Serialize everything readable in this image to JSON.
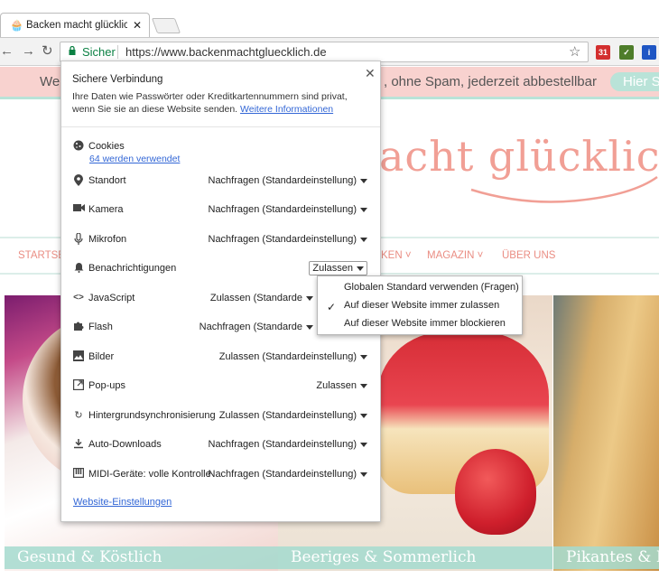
{
  "browser": {
    "tab_title": "Backen macht glücklich -",
    "tab_favicon": "cupcake-icon",
    "omnibox": {
      "secure_label": "Sicher",
      "url": "https://www.backenmachtgluecklich.de"
    },
    "extensions": [
      "calendar-extension-icon",
      "checklist-extension-icon",
      "info-extension-icon"
    ]
  },
  "page": {
    "banner_left": "Wei",
    "banner_text": ", ohne Spam, jederzeit abbestellbar",
    "banner_button": "Hier S",
    "logo_text": "acht glücklich",
    "nav": {
      "startseite": "STARTSE",
      "backen": "KEN",
      "magazin": "MAGAZIN",
      "ueber_uns": "ÜBER UNS"
    },
    "captions": [
      "Gesund & Köstlich",
      "Beeriges & Sommerlich",
      "Pikantes & Fin"
    ]
  },
  "popup": {
    "title": "Sichere Verbindung",
    "description": "Ihre Daten wie Passwörter oder Kreditkartennummern sind privat, wenn Sie sie an diese Website senden.",
    "more_info_link": "Weitere Informationen",
    "cookies": {
      "label": "Cookies",
      "link": "64 werden verwendet"
    },
    "permissions": [
      {
        "id": "standort",
        "label": "Standort",
        "value": "Nachfragen (Standardeinstellung)",
        "icon": "location-pin-icon"
      },
      {
        "id": "kamera",
        "label": "Kamera",
        "value": "Nachfragen (Standardeinstellung)",
        "icon": "camera-icon"
      },
      {
        "id": "mikrofon",
        "label": "Mikrofon",
        "value": "Nachfragen (Standardeinstellung)",
        "icon": "microphone-icon"
      },
      {
        "id": "benachrichtigungen",
        "label": "Benachrichtigungen",
        "value": "Zulassen",
        "icon": "bell-icon"
      },
      {
        "id": "javascript",
        "label": "JavaScript",
        "value": "Zulassen (Standarde",
        "icon": "code-icon"
      },
      {
        "id": "flash",
        "label": "Flash",
        "value": "Nachfragen (Standarde",
        "icon": "puzzle-icon"
      },
      {
        "id": "bilder",
        "label": "Bilder",
        "value": "Zulassen (Standardeinstellung)",
        "icon": "image-icon"
      },
      {
        "id": "popups",
        "label": "Pop-ups",
        "value": "Zulassen",
        "icon": "popup-icon"
      },
      {
        "id": "hintergrund",
        "label": "Hintergrundsynchronisierung",
        "value": "Zulassen (Standardeinstellung)",
        "icon": "sync-icon"
      },
      {
        "id": "downloads",
        "label": "Auto-Downloads",
        "value": "Nachfragen (Standardeinstellung)",
        "icon": "download-icon"
      },
      {
        "id": "midi",
        "label": "MIDI-Geräte: volle Kontrolle",
        "value": "Nachfragen (Standardeinstellung)",
        "icon": "midi-icon"
      }
    ],
    "site_settings_link": "Website-Einstellungen"
  },
  "dropdown": {
    "options": [
      "Globalen Standard verwenden (Fragen)",
      "Auf dieser Website immer zulassen",
      "Auf dieser Website immer blockieren"
    ],
    "selected_index": 1
  },
  "colors": {
    "secure_green": "#0b8043",
    "link_blue": "#3367d6",
    "banner_pink": "#f8d2cf",
    "accent_mint": "#b9e3d8",
    "logo_salmon": "#f19f95"
  }
}
